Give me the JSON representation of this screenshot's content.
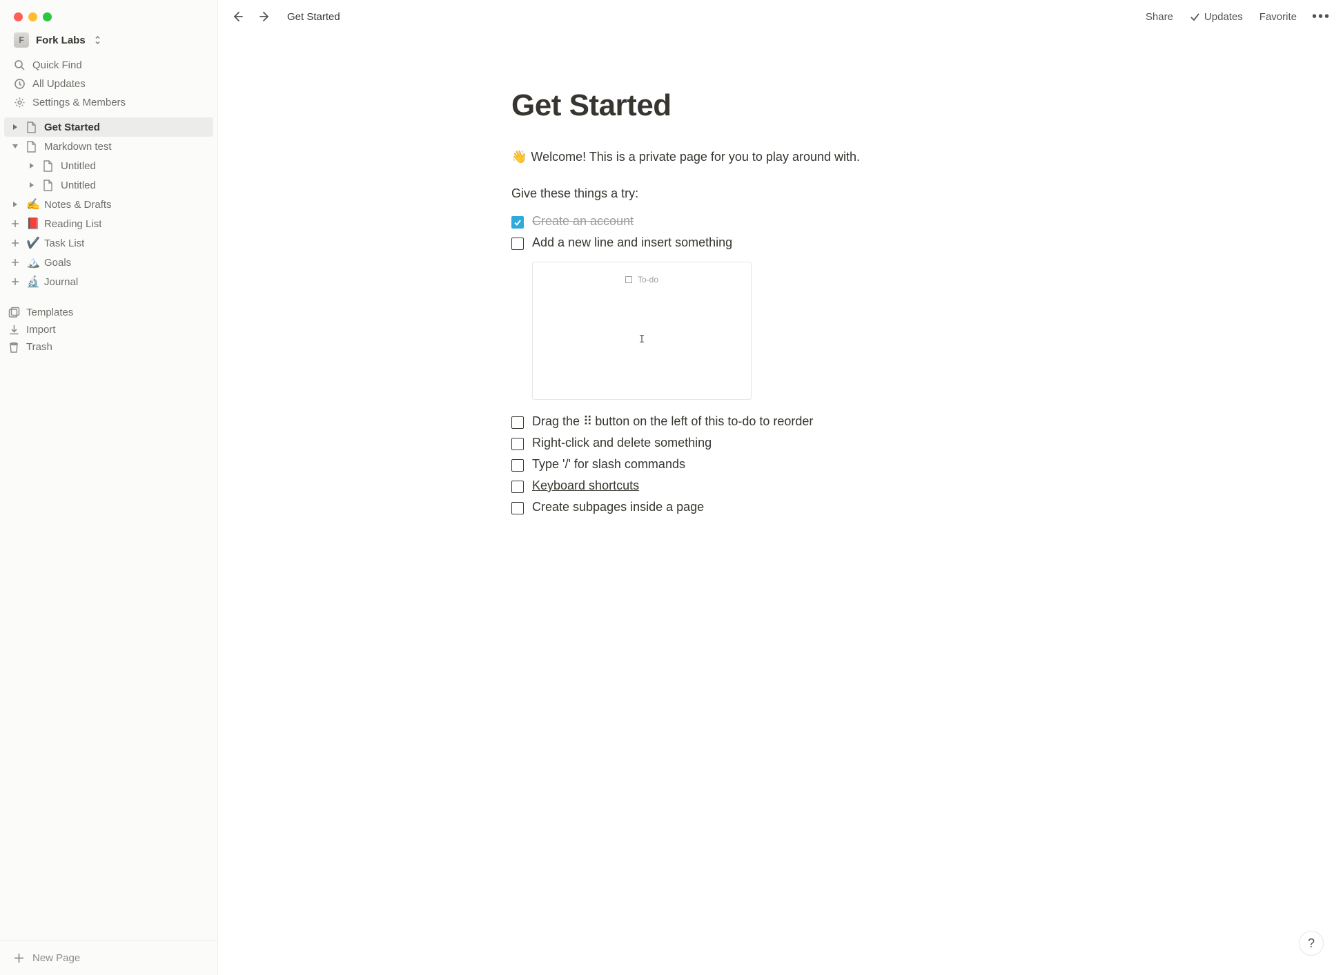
{
  "workspace": {
    "initial": "F",
    "name": "Fork Labs"
  },
  "sidebar": {
    "quick_find": "Quick Find",
    "all_updates": "All Updates",
    "settings": "Settings & Members",
    "templates": "Templates",
    "import": "Import",
    "trash": "Trash",
    "new_page": "New Page",
    "tree": {
      "get_started": "Get Started",
      "markdown_test": "Markdown test",
      "untitled1": "Untitled",
      "untitled2": "Untitled",
      "notes_drafts": "Notes & Drafts",
      "reading_list": "Reading List",
      "task_list": "Task List",
      "goals": "Goals",
      "journal": "Journal"
    }
  },
  "topbar": {
    "breadcrumb": "Get Started",
    "share": "Share",
    "updates": "Updates",
    "favorite": "Favorite"
  },
  "page": {
    "title": "Get Started",
    "welcome": "Welcome! This is a private page for you to play around with.",
    "try_prompt": "Give these things a try:",
    "todo1": "Create an account",
    "todo2": "Add a new line and insert something",
    "inset_todo": "To-do",
    "todo3_pre": "Drag the ",
    "todo3_post": " button on the left of this to-do to reorder",
    "todo4": "Right-click and delete something",
    "todo5": "Type '/' for slash commands",
    "todo6": "Keyboard shortcuts",
    "todo7": "Create subpages inside a page"
  },
  "help": "?"
}
